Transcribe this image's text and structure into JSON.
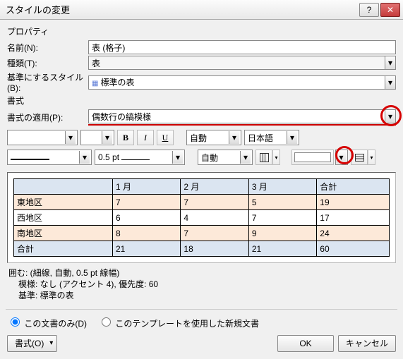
{
  "window": {
    "title": "スタイルの変更"
  },
  "sections": {
    "properties": "プロパティ",
    "format": "書式"
  },
  "props": {
    "name_label": "名前(N):",
    "name_value": "表 (格子)",
    "type_label": "種類(T):",
    "type_value": "表",
    "based_label": "基準にするスタイル(B):",
    "based_value": "標準の表"
  },
  "apply": {
    "label": "書式の適用(P):",
    "value": "偶数行の縞模様"
  },
  "toolbar": {
    "font": "",
    "font_size": "",
    "bold": "B",
    "italic": "I",
    "underline": "U",
    "color": "自動",
    "lang": "日本語"
  },
  "toolbar2": {
    "line_weight": "0.5 pt",
    "line_color": "自動"
  },
  "chart_data": {
    "type": "table",
    "columns": [
      "",
      "1 月",
      "2 月",
      "3 月",
      "合計"
    ],
    "rows": [
      [
        "東地区",
        "7",
        "7",
        "5",
        "19"
      ],
      [
        "西地区",
        "6",
        "4",
        "7",
        "17"
      ],
      [
        "南地区",
        "8",
        "7",
        "9",
        "24"
      ],
      [
        "合計",
        "21",
        "18",
        "21",
        "60"
      ]
    ]
  },
  "info": {
    "line1": "囲む: (細線, 自動, 0.5 pt 線幅)",
    "line2": "模様: なし (アクセント 4), 優先度: 60",
    "line3": "基準: 標準の表"
  },
  "radio": {
    "doc_only": "この文書のみ(D)",
    "template": "このテンプレートを使用した新規文書"
  },
  "buttons": {
    "format": "書式(O)",
    "ok": "OK",
    "cancel": "キャンセル"
  }
}
